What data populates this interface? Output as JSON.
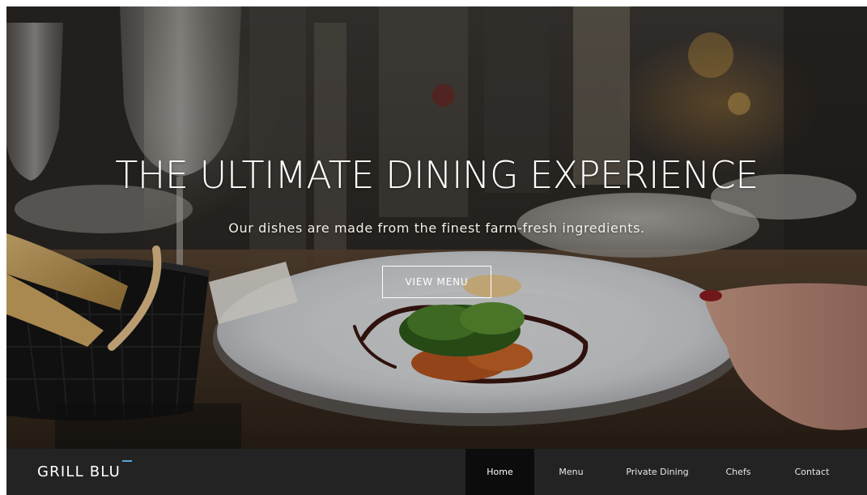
{
  "hero": {
    "title": "THE ULTIMATE DINING EXPERIENCE",
    "subtitle": "Our dishes are made from the finest farm-fresh ingredients.",
    "cta_label": "VIEW MENU"
  },
  "navbar": {
    "brand": "GRILL BLU",
    "brand_accent_color": "#5aa7d6",
    "items": [
      {
        "label": "Home",
        "active": true
      },
      {
        "label": "Menu",
        "active": false
      },
      {
        "label": "Private Dining",
        "active": false
      },
      {
        "label": "Chefs",
        "active": false
      },
      {
        "label": "Contact",
        "active": false
      }
    ]
  }
}
